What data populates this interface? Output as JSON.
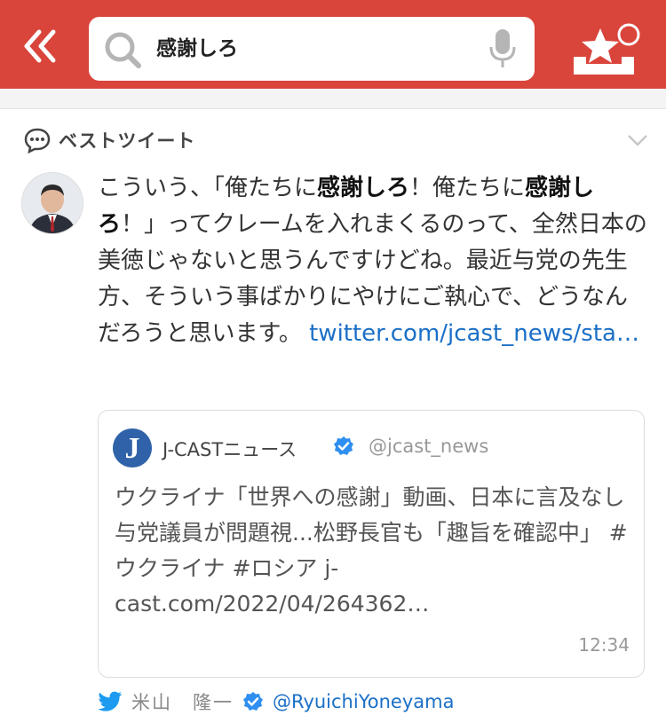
{
  "header": {
    "search_query": "感謝しろ",
    "brand_color": "#d9443b",
    "icons": [
      "double-chevron-left-icon",
      "search-icon",
      "microphone-icon",
      "favorite-star-tray-icon"
    ]
  },
  "section": {
    "title": "ベストツイート"
  },
  "tweet": {
    "text_1": "こういう、「俺たちに",
    "hl_1": "感謝しろ",
    "text_2": "！俺たちに",
    "hl_2": "感謝しろ",
    "text_3": "！」ってクレームを入れまくるのって、全然日本の美徳じゃないと思うんですけどね。最近与党の先生方、そういう事ばかりにやけにご執心で、どうなんだろうと思います。 ",
    "link": "twitter.com/jcast_news/sta…",
    "author_name": "米山　隆一",
    "author_handle": "@RyuichiYoneyama"
  },
  "quote": {
    "logo_letter": "J",
    "name": "J-CASTニュース",
    "handle": "@jcast_news",
    "text": "ウクライナ「世界への感謝」動画、日本に言及なし　与党議員が問題視...松野長官も「趣旨を確認中」 #ウクライナ #ロシア j-cast.com/2022/04/264362…",
    "time": "12:34"
  }
}
